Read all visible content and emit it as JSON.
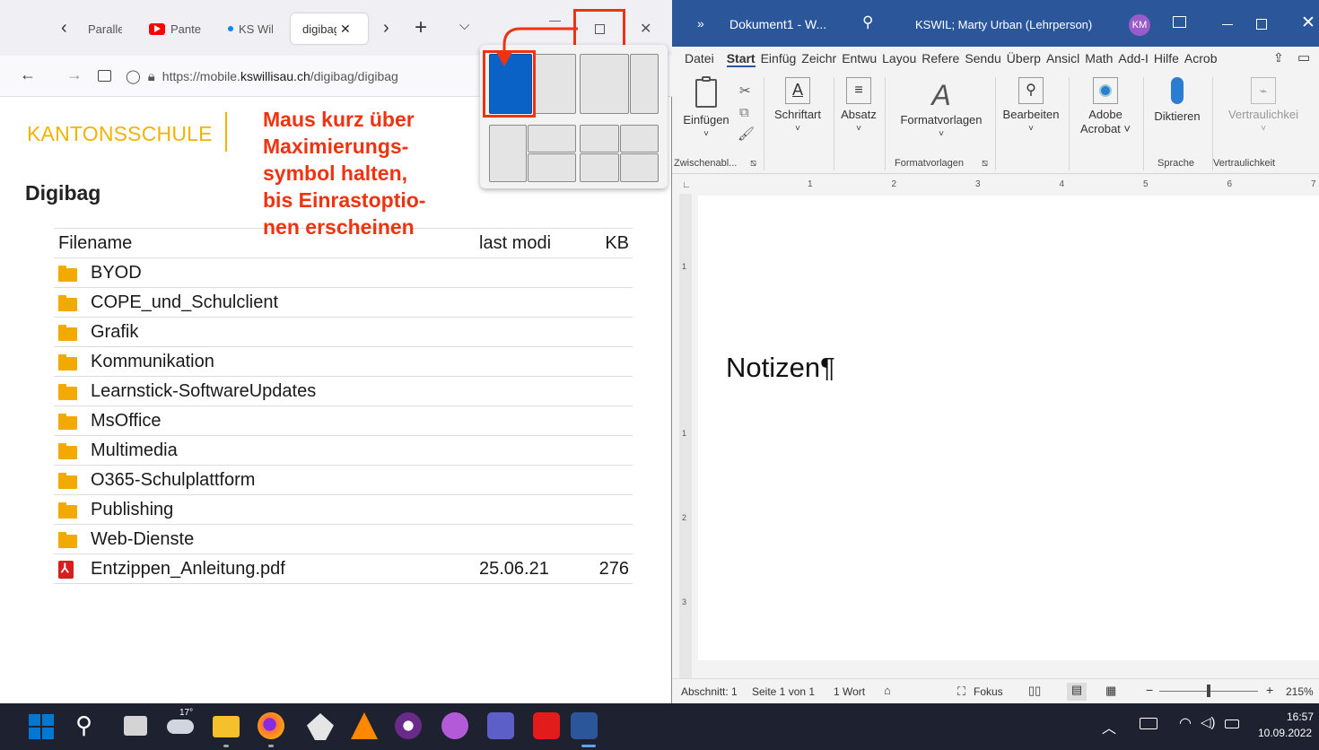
{
  "browser": {
    "tabs": [
      "Paralle",
      "Pante",
      "KS Wil"
    ],
    "active_tab": "digibag",
    "url_prefix": "https://mobile.",
    "url_domain": "kswillisau.ch",
    "url_path": "/digibag/digibag",
    "site_brand": "KANTONSSCHULE",
    "page_title": "Digibag",
    "table_header": {
      "name": "Filename",
      "date": "last modi",
      "kb": "KB"
    },
    "folders": [
      "BYOD",
      "COPE_und_Schulclient",
      "Grafik",
      "Kommunikation",
      "Learnstick-SoftwareUpdates",
      "MsOffice",
      "Multimedia",
      "O365-Schulplattform",
      "Publishing",
      "Web-Dienste"
    ],
    "file": {
      "name": "Entzippen_Anleitung.pdf",
      "date": "25.06.21",
      "kb": "276"
    }
  },
  "annotation": "Maus kurz über\nMaximierungs-\nsymbol halten,\nbis Einrastoptio-\nnen erscheinen",
  "colors": {
    "accent": "#ee3311",
    "word_blue": "#2b579a",
    "snap_selected": "#0a62c6"
  },
  "word": {
    "chevron": "»",
    "doc_title": "Dokument1 - W...",
    "user": "KSWIL; Marty Urban (Lehrperson)",
    "initials": "KM",
    "menu": [
      "Datei",
      "Start",
      "Einfüg",
      "Zeichr",
      "Entwu",
      "Layou",
      "Refere",
      "Sendu",
      "Überp",
      "Ansicl",
      "Math",
      "Add-I",
      "Hilfe",
      "Acrob"
    ],
    "ribbon": {
      "einfuegen": "Einfügen",
      "schriftart": "Schriftart",
      "absatz": "Absatz",
      "formatvorlagen": "Formatvorlagen",
      "bearbeiten": "Bearbeiten",
      "adobe": "Adobe",
      "acrobat": "Acrobat ˅",
      "diktieren": "Diktieren",
      "vertraulichkeit": "Vertraulichkei"
    },
    "groups": {
      "zwischenablage": "Zwischenabl...",
      "formatvorlagen": "Formatvorlagen",
      "sprache": "Sprache",
      "vertraulichkeit": "Vertraulichkeit"
    },
    "ruler_numbers": [
      "1",
      "2",
      "3",
      "4",
      "5",
      "6",
      "7"
    ],
    "vruler_numbers": [
      "1",
      "1",
      "2",
      "3"
    ],
    "body_text": "Notizen¶",
    "status": {
      "abschnitt": "Abschnitt: 1",
      "seite": "Seite 1 von 1",
      "wort": "1 Wort",
      "fokus": "Fokus",
      "zoom": "215%"
    }
  },
  "taskbar": {
    "weather": "17°",
    "time": "16:57",
    "date": "10.09.2022"
  }
}
